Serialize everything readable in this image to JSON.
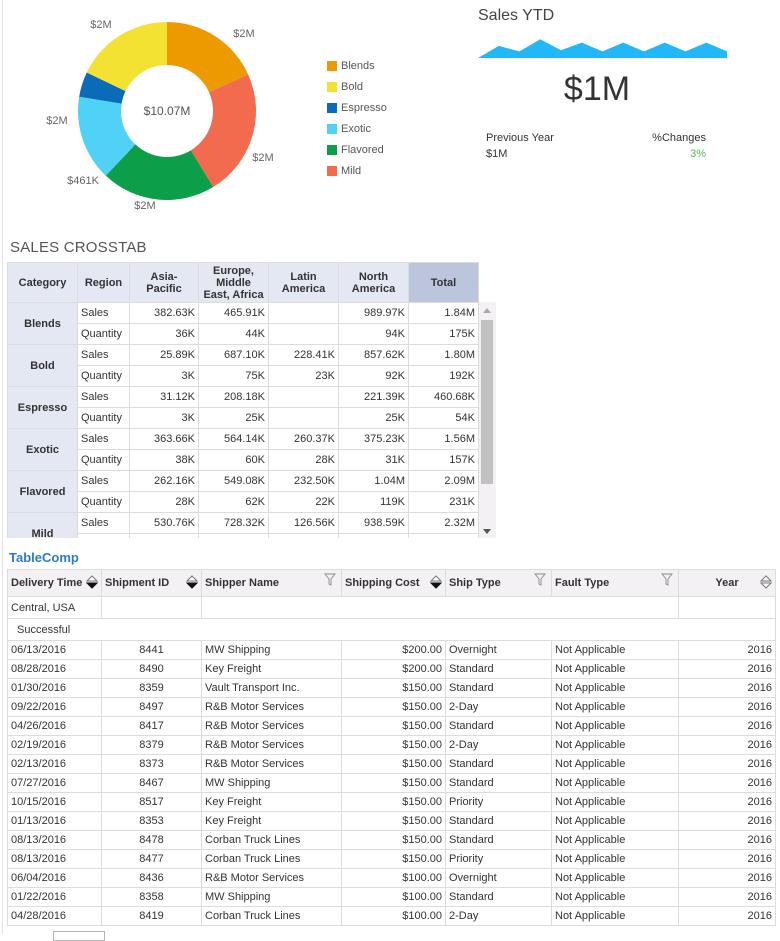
{
  "donut": {
    "center_label": "$10.07M",
    "slices": [
      {
        "name": "Blends",
        "label": "$2M",
        "value": 1.84,
        "color": "#ec9a00"
      },
      {
        "name": "Mild",
        "label": "$2M",
        "value": 2.32,
        "color": "#f26b4e"
      },
      {
        "name": "Flavored",
        "label": "$2M",
        "value": 2.09,
        "color": "#0d9e4a"
      },
      {
        "name": "Exotic",
        "label": "$2M",
        "value": 1.56,
        "color": "#4fd2f5"
      },
      {
        "name": "Espresso",
        "label": "$461K",
        "value": 0.46,
        "color": "#0a6cb8"
      },
      {
        "name": "Bold",
        "label": "$2M",
        "value": 1.8,
        "color": "#f4e233"
      }
    ],
    "legend": [
      {
        "label": "Blends",
        "color": "#ec9a00"
      },
      {
        "label": "Bold",
        "color": "#f4e233"
      },
      {
        "label": "Espresso",
        "color": "#0a6cb8"
      },
      {
        "label": "Exotic",
        "color": "#4fd2f5"
      },
      {
        "label": "Flavored",
        "color": "#0d9e4a"
      },
      {
        "label": "Mild",
        "color": "#f26b4e"
      }
    ]
  },
  "kpi": {
    "title": "Sales YTD",
    "value": "$1M",
    "previous_year_label": "Previous Year",
    "previous_year_value": "$1M",
    "change_label": "%Changes",
    "change_value": "3%",
    "change_color": "#5cb85c",
    "sparkline_color": "#22b8f7",
    "sparkline_values": [
      0,
      0.55,
      0.3,
      0.85,
      0.35,
      0.7,
      0.3,
      0.7,
      0.3,
      0.7,
      0.3,
      0.7,
      0.3
    ]
  },
  "crosstab": {
    "title": "SALES CROSSTAB",
    "headers": [
      "Category",
      "Region",
      "Asia-Pacific",
      "Europe, Middle East, Africa",
      "Latin America",
      "North America",
      "Total"
    ],
    "rows": [
      {
        "category": "Blends",
        "sales": [
          "382.63K",
          "465.91K",
          "",
          "989.97K",
          "1.84M"
        ],
        "quantity": [
          "36K",
          "44K",
          "",
          "94K",
          "175K"
        ]
      },
      {
        "category": "Bold",
        "sales": [
          "25.89K",
          "687.10K",
          "228.41K",
          "857.62K",
          "1.80M"
        ],
        "quantity": [
          "3K",
          "75K",
          "23K",
          "92K",
          "192K"
        ]
      },
      {
        "category": "Espresso",
        "sales": [
          "31.12K",
          "208.18K",
          "",
          "221.39K",
          "460.68K"
        ],
        "quantity": [
          "3K",
          "25K",
          "",
          "25K",
          "54K"
        ]
      },
      {
        "category": "Exotic",
        "sales": [
          "363.66K",
          "564.14K",
          "260.37K",
          "375.23K",
          "1.56M"
        ],
        "quantity": [
          "38K",
          "60K",
          "28K",
          "31K",
          "157K"
        ]
      },
      {
        "category": "Flavored",
        "sales": [
          "262.16K",
          "549.08K",
          "232.50K",
          "1.04M",
          "2.09M"
        ],
        "quantity": [
          "28K",
          "62K",
          "22K",
          "119K",
          "231K"
        ]
      },
      {
        "category": "Mild",
        "sales": [
          "530.76K",
          "728.32K",
          "126.56K",
          "938.59K",
          "2.32M"
        ],
        "quantity": [
          "",
          "",
          "",
          "",
          ""
        ]
      }
    ],
    "measure_labels": {
      "sales": "Sales",
      "quantity": "Quantity"
    }
  },
  "tablecomp": {
    "title": "TableComp",
    "columns": [
      {
        "label": "Delivery Time",
        "icon": "sort"
      },
      {
        "label": "Shipment ID",
        "icon": "sort"
      },
      {
        "label": "Shipper Name",
        "icon": "filter"
      },
      {
        "label": "Shipping Cost",
        "icon": "sort"
      },
      {
        "label": "Ship Type",
        "icon": "filter"
      },
      {
        "label": "Fault Type",
        "icon": "filter"
      },
      {
        "label": "Year",
        "icon": "sort-inactive"
      }
    ],
    "group1": "Central, USA",
    "group2": "Successful",
    "rows": [
      [
        "06/13/2016",
        "8441",
        "MW Shipping",
        "$200.00",
        "Overnight",
        "Not Applicable",
        "2016"
      ],
      [
        "08/28/2016",
        "8490",
        "Key Freight",
        "$200.00",
        "Standard",
        "Not Applicable",
        "2016"
      ],
      [
        "01/30/2016",
        "8359",
        "Vault Transport Inc.",
        "$150.00",
        "Standard",
        "Not Applicable",
        "2016"
      ],
      [
        "09/22/2016",
        "8497",
        "R&B Motor Services",
        "$150.00",
        "2-Day",
        "Not Applicable",
        "2016"
      ],
      [
        "04/26/2016",
        "8417",
        "R&B Motor Services",
        "$150.00",
        "Standard",
        "Not Applicable",
        "2016"
      ],
      [
        "02/19/2016",
        "8379",
        "R&B Motor Services",
        "$150.00",
        "2-Day",
        "Not Applicable",
        "2016"
      ],
      [
        "02/13/2016",
        "8373",
        "R&B Motor Services",
        "$150.00",
        "Standard",
        "Not Applicable",
        "2016"
      ],
      [
        "07/27/2016",
        "8467",
        "MW Shipping",
        "$150.00",
        "Standard",
        "Not Applicable",
        "2016"
      ],
      [
        "10/15/2016",
        "8517",
        "Key Freight",
        "$150.00",
        "Priority",
        "Not Applicable",
        "2016"
      ],
      [
        "01/13/2016",
        "8353",
        "Key Freight",
        "$150.00",
        "Standard",
        "Not Applicable",
        "2016"
      ],
      [
        "08/13/2016",
        "8478",
        "Corban Truck Lines",
        "$150.00",
        "Standard",
        "Not Applicable",
        "2016"
      ],
      [
        "08/13/2016",
        "8477",
        "Corban Truck Lines",
        "$150.00",
        "Priority",
        "Not Applicable",
        "2016"
      ],
      [
        "06/04/2016",
        "8436",
        "R&B Motor Services",
        "$100.00",
        "Overnight",
        "Not Applicable",
        "2016"
      ],
      [
        "01/22/2016",
        "8358",
        "MW Shipping",
        "$100.00",
        "Standard",
        "Not Applicable",
        "2016"
      ],
      [
        "04/28/2016",
        "8419",
        "Corban Truck Lines",
        "$100.00",
        "2-Day",
        "Not Applicable",
        "2016"
      ]
    ]
  }
}
